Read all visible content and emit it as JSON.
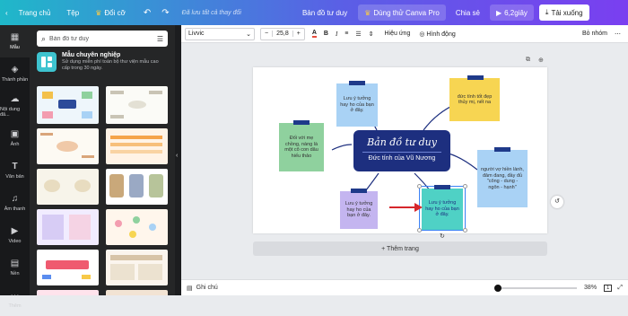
{
  "topbar": {
    "home": "Trang chủ",
    "file": "Tệp",
    "resize": "Đổi cỡ",
    "saved": "Đã lưu tất cả thay đổi",
    "doc_title": "Bản đồ tư duy",
    "try_pro": "Dùng thử Canva Pro",
    "share": "Chia sẻ",
    "timer": "6,2giây",
    "download": "Tải xuống"
  },
  "sidebar": {
    "items": [
      {
        "label": "Mẫu",
        "icon": "template-icon"
      },
      {
        "label": "Thành phần",
        "icon": "elements-icon"
      },
      {
        "label": "Nội dung đã...",
        "icon": "upload-icon"
      },
      {
        "label": "Ảnh",
        "icon": "photo-icon"
      },
      {
        "label": "Văn bản",
        "icon": "text-icon"
      },
      {
        "label": "Âm thanh",
        "icon": "audio-icon"
      },
      {
        "label": "Video",
        "icon": "video-icon"
      },
      {
        "label": "Nền",
        "icon": "background-icon"
      },
      {
        "label": "Thêm",
        "icon": "more-icon"
      }
    ]
  },
  "panel": {
    "search_value": "Bản đồ tư duy",
    "promo_title": "Mẫu chuyên nghiệp",
    "promo_desc": "Sử dụng miễn phí toàn bộ thư viện mẫu cao cấp trong 30 ngày."
  },
  "toolbar": {
    "font": "Livvic",
    "font_size": "25,8",
    "minus": "−",
    "plus": "+",
    "effects": "Hiệu ứng",
    "animate": "Hình động",
    "ungroup": "Bỏ nhóm"
  },
  "canvas": {
    "center_title": "Bản đồ tư duy",
    "center_subtitle": "Đức tính của Vũ Nương",
    "notes": [
      "Lưu ý tưởng hay ho của bạn ở đây.",
      "đức tính tốt đẹp thủy mị, nết na",
      "Đối với mẹ chồng, nàng là một cô con dâu hiếu thảo",
      "người vợ hiền lành, đảm đang, đầy đủ \"công - dung - ngôn - hạnh\"",
      "Lưu ý tưởng hay ho của bạn ở đây.",
      "Lưu ý tưởng hay ho của bạn ở đây."
    ],
    "add_page": "+ Thêm trang"
  },
  "statusbar": {
    "notes": "Ghi chú",
    "zoom": "38%",
    "page_num": "1"
  },
  "colors": {
    "note_blue": "#a9d2f5",
    "note_yellow": "#f7d552",
    "note_green": "#8fd19e",
    "note_lavender": "#c4b5f0",
    "note_teal": "#4fd1c5",
    "tape": "#1f3a8a",
    "center": "#1d2f7f"
  }
}
